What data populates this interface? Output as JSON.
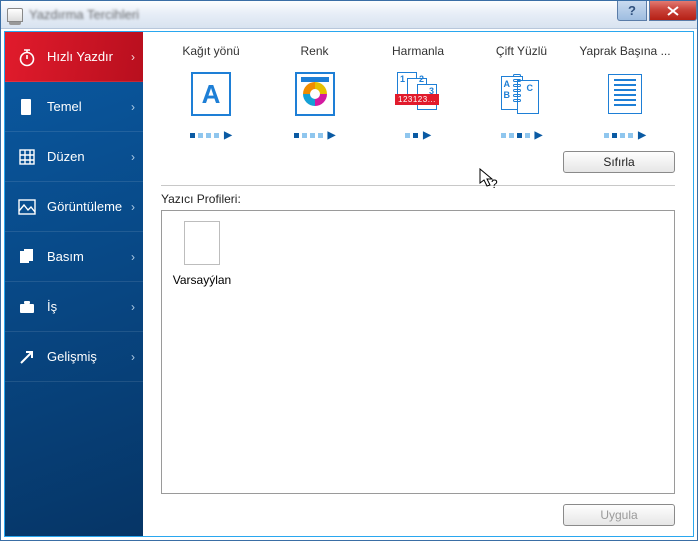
{
  "window": {
    "title": "Yazdırma Tercihleri"
  },
  "sidebar": {
    "items": [
      {
        "label": "Hızlı Yazdır",
        "icon": "stopwatch-icon",
        "active": true
      },
      {
        "label": "Temel",
        "icon": "document-icon"
      },
      {
        "label": "Düzen",
        "icon": "grid-icon"
      },
      {
        "label": "Görüntüleme",
        "icon": "image-icon"
      },
      {
        "label": "Basım",
        "icon": "pages-icon"
      },
      {
        "label": "İş",
        "icon": "briefcase-icon"
      },
      {
        "label": "Gelişmiş",
        "icon": "arrow-up-right-icon"
      }
    ]
  },
  "options": [
    {
      "label": "Kağıt yönü",
      "icon": "orientation",
      "selected_index": 0,
      "count": 4
    },
    {
      "label": "Renk",
      "icon": "color",
      "selected_index": 0,
      "count": 4
    },
    {
      "label": "Harmanla",
      "icon": "collate",
      "selected_index": 1,
      "count": 2
    },
    {
      "label": "Çift Yüzlü",
      "icon": "duplex",
      "selected_index": 2,
      "count": 4
    },
    {
      "label": "Yaprak Başına ...",
      "icon": "nup",
      "selected_index": 1,
      "count": 4
    }
  ],
  "collate_badge": "123123...",
  "buttons": {
    "reset": "Sıfırla",
    "apply": "Uygula"
  },
  "profiles": {
    "label": "Yazıcı Profileri:",
    "items": [
      {
        "name": "Varsayýlan"
      }
    ]
  }
}
